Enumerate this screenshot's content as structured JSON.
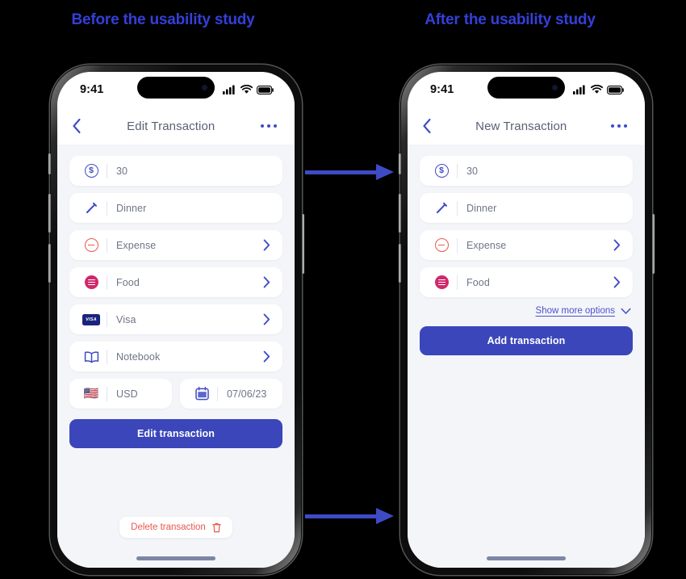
{
  "headings": {
    "left": "Before the usability study",
    "right": "After the usability study",
    "color": "#3440d8"
  },
  "colors": {
    "accent": "#3f4bc4",
    "cta": "#3b46ba",
    "danger": "#e8584e",
    "food": "#d1276b",
    "screen_bg": "#f4f5f9",
    "link": "#4a52cc"
  },
  "phones": [
    {
      "id": "before",
      "status_bar": {
        "time": "9:41",
        "cellular": "signal-bars-icon",
        "wifi": "wifi-icon",
        "battery": "battery-icon"
      },
      "nav": {
        "back": "chevron-left-icon",
        "title": "Edit Transaction",
        "more": "more-options-icon"
      },
      "fields": [
        {
          "icon": "dollar-circle-icon",
          "label": "30",
          "chevron": false
        },
        {
          "icon": "pencil-icon",
          "label": "Dinner",
          "chevron": false
        },
        {
          "icon": "minus-circle-icon",
          "label": "Expense",
          "chevron": true
        },
        {
          "icon": "food-burger-icon",
          "label": "Food",
          "chevron": true
        },
        {
          "icon": "visa-card-icon",
          "label": "Visa",
          "chevron": true
        },
        {
          "icon": "notebook-icon",
          "label": "Notebook",
          "chevron": true
        }
      ],
      "row_fields": [
        {
          "icon": "us-flag-icon",
          "label": "USD"
        },
        {
          "icon": "calendar-icon",
          "label": "07/06/23"
        }
      ],
      "cta": "Edit transaction",
      "delete": {
        "label": "Delete transaction",
        "icon": "trash-icon"
      }
    },
    {
      "id": "after",
      "status_bar": {
        "time": "9:41",
        "cellular": "signal-bars-icon",
        "wifi": "wifi-icon",
        "battery": "battery-icon"
      },
      "nav": {
        "back": "chevron-left-icon",
        "title": "New Transaction",
        "more": "more-options-icon"
      },
      "fields": [
        {
          "icon": "dollar-circle-icon",
          "label": "30",
          "chevron": false
        },
        {
          "icon": "pencil-icon",
          "label": "Dinner",
          "chevron": false
        },
        {
          "icon": "minus-circle-icon",
          "label": "Expense",
          "chevron": true
        },
        {
          "icon": "food-burger-icon",
          "label": "Food",
          "chevron": true
        }
      ],
      "show_more": {
        "label": "Show more options",
        "icon": "chevron-down-icon"
      },
      "cta": "Add transaction"
    }
  ],
  "arrows": [
    {
      "name": "arrow-top",
      "direction": "right"
    },
    {
      "name": "arrow-bottom",
      "direction": "right"
    }
  ]
}
